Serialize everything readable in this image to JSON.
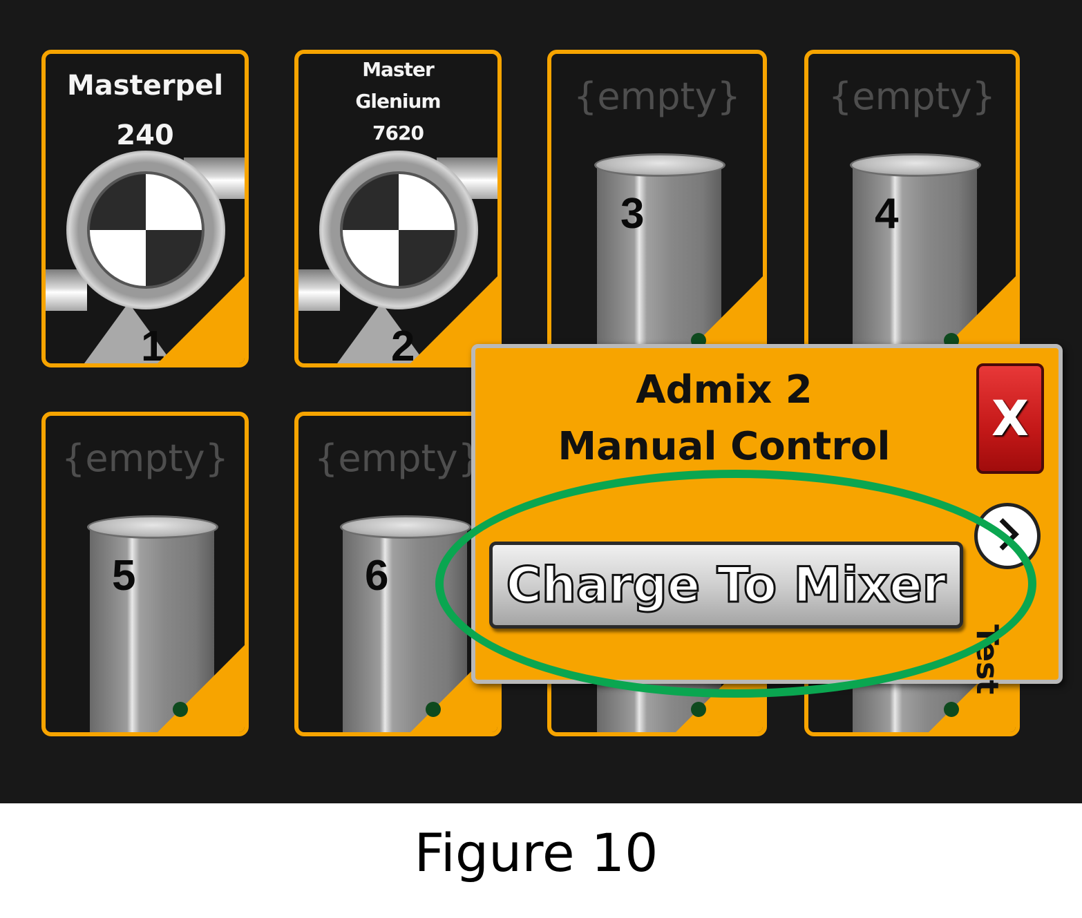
{
  "tiles": [
    {
      "name": "Masterpel\n240",
      "number": "1"
    },
    {
      "name": "Master\nGlenium\n7620",
      "number": "2"
    },
    {
      "name": "{empty}",
      "number": "3"
    },
    {
      "name": "{empty}",
      "number": "4"
    },
    {
      "name": "{empty}",
      "number": "5"
    },
    {
      "name": "{empty}",
      "number": "6"
    }
  ],
  "popup": {
    "title_line1": "Admix 2",
    "title_line2": "Manual Control",
    "close_label": "X",
    "charge_label": "Charge To Mixer",
    "side_label": "Test"
  },
  "caption": "Figure 10",
  "colors": {
    "accent": "#f7a400",
    "background": "#181818",
    "close": "#d42020",
    "highlight": "#0aa650"
  }
}
